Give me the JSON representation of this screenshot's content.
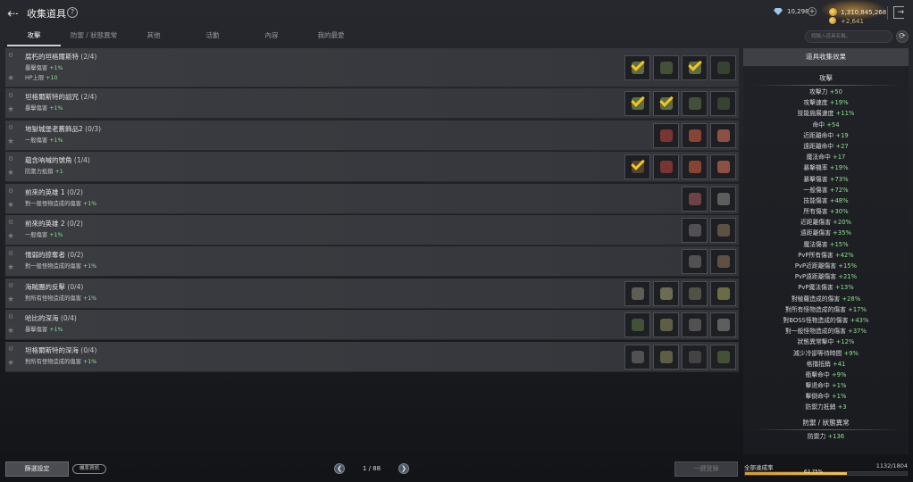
{
  "header": {
    "title": "收集道具",
    "help_icon": "?",
    "diamond": "10,298",
    "silver": "1,310,845,268",
    "silver_sub": "+2,641"
  },
  "tabs": [
    {
      "label": "攻擊",
      "active": true
    },
    {
      "label": "防禦 / 狀態異常",
      "active": false
    },
    {
      "label": "其他",
      "active": false
    },
    {
      "label": "活動",
      "active": false
    },
    {
      "label": "內容",
      "active": false
    },
    {
      "label": "我的最愛",
      "active": false
    }
  ],
  "search": {
    "placeholder": "請輸入道具名稱。"
  },
  "collections": [
    {
      "name": "腐朽的坦格爾斯特",
      "count": "(2/4)",
      "effects": [
        {
          "label": "暴擊傷害",
          "value": "+1%"
        },
        {
          "label": "HP上限",
          "value": "+10"
        }
      ],
      "slots": [
        {
          "checked": true,
          "color": "#6a7a4a"
        },
        {
          "checked": false,
          "color": "#4a5a3a"
        },
        {
          "checked": true,
          "color": "#6a7a4a"
        },
        {
          "checked": false,
          "color": "#3a4a32"
        }
      ]
    },
    {
      "name": "坦格爾斯特的詛咒",
      "count": "(2/4)",
      "effects": [
        {
          "label": "暴擊傷害",
          "value": "+1%"
        }
      ],
      "slots": [
        {
          "checked": true,
          "color": "#6a7a4a"
        },
        {
          "checked": true,
          "color": "#6a7a4a"
        },
        {
          "checked": false,
          "color": "#4a5a3a"
        },
        {
          "checked": false,
          "color": "#3a4a32"
        }
      ]
    },
    {
      "name": "地獄城堡老舊飾品2",
      "count": "(0/3)",
      "effects": [
        {
          "label": "一般傷害",
          "value": "+1%"
        }
      ],
      "slots": [
        {
          "checked": false,
          "color": "#8a3a34"
        },
        {
          "checked": false,
          "color": "#9a4a3a"
        },
        {
          "checked": false,
          "color": "#a05a4a"
        }
      ]
    },
    {
      "name": "蘊含吶喊的號角",
      "count": "(1/4)",
      "effects": [
        {
          "label": "防禦力抵銷",
          "value": "+1"
        }
      ],
      "slots": [
        {
          "checked": true,
          "color": "#5a4a3a"
        },
        {
          "checked": false,
          "color": "#8a3a34"
        },
        {
          "checked": false,
          "color": "#9a4a3a"
        },
        {
          "checked": false,
          "color": "#a05a4a"
        }
      ]
    },
    {
      "name": "前來的英雄 1",
      "count": "(0/2)",
      "effects": [
        {
          "label": "對一般怪物造成的傷害",
          "value": "+1%"
        }
      ],
      "slots": [
        {
          "checked": false,
          "color": "#7a4a4a"
        },
        {
          "checked": false,
          "color": "#6a6a6a"
        }
      ]
    },
    {
      "name": "前來的英雄 2",
      "count": "(0/2)",
      "effects": [
        {
          "label": "一般傷害",
          "value": "+1%"
        }
      ],
      "slots": [
        {
          "checked": false,
          "color": "#5a5a5a"
        },
        {
          "checked": false,
          "color": "#6a5a4a"
        }
      ]
    },
    {
      "name": "懦弱的掠奪者",
      "count": "(0/2)",
      "effects": [
        {
          "label": "對一般怪物造成的傷害",
          "value": "+1%"
        }
      ],
      "slots": [
        {
          "checked": false,
          "color": "#5a5a5a"
        },
        {
          "checked": false,
          "color": "#6a5a4a"
        }
      ]
    },
    {
      "name": "海賊團的反擊",
      "count": "(0/4)",
      "effects": [
        {
          "label": "對所有怪物造成的傷害",
          "value": "+1%"
        }
      ],
      "slots": [
        {
          "checked": false,
          "color": "#6a6a5a"
        },
        {
          "checked": false,
          "color": "#7a7a5a"
        },
        {
          "checked": false,
          "color": "#5a5a4a"
        },
        {
          "checked": false,
          "color": "#7a7a4a"
        }
      ]
    },
    {
      "name": "哈比的深海",
      "count": "(0/4)",
      "effects": [
        {
          "label": "暴擊傷害",
          "value": "+1%"
        }
      ],
      "slots": [
        {
          "checked": false,
          "color": "#4a5a3a"
        },
        {
          "checked": false,
          "color": "#6a6a4a"
        },
        {
          "checked": false,
          "color": "#5a5a5a"
        },
        {
          "checked": false,
          "color": "#6a6a6a"
        }
      ]
    },
    {
      "name": "坦格爾斯特的深海",
      "count": "(0/4)",
      "effects": [
        {
          "label": "對所有怪物造成的傷害",
          "value": "+1%"
        }
      ],
      "slots": [
        {
          "checked": false,
          "color": "#5a5a5a"
        },
        {
          "checked": false,
          "color": "#6a6a4a"
        },
        {
          "checked": false,
          "color": "#4a4a4a"
        },
        {
          "checked": false,
          "color": "#4a5a3a"
        }
      ]
    }
  ],
  "panel": {
    "title": "道具收集效果",
    "attack_title": "攻擊",
    "attack_stats": [
      {
        "label": "攻擊力",
        "value": "+50"
      },
      {
        "label": "攻擊速度",
        "value": "+19%"
      },
      {
        "label": "技能施展速度",
        "value": "+11%"
      },
      {
        "label": "命中",
        "value": "+54"
      },
      {
        "label": "近距離命中",
        "value": "+19"
      },
      {
        "label": "遠距離命中",
        "value": "+27"
      },
      {
        "label": "魔法命中",
        "value": "+17"
      },
      {
        "label": "暴擊機率",
        "value": "+19%"
      },
      {
        "label": "暴擊傷害",
        "value": "+73%"
      },
      {
        "label": "一般傷害",
        "value": "+72%"
      },
      {
        "label": "技能傷害",
        "value": "+48%"
      },
      {
        "label": "所有傷害",
        "value": "+30%"
      },
      {
        "label": "近距離傷害",
        "value": "+20%"
      },
      {
        "label": "遠距離傷害",
        "value": "+35%"
      },
      {
        "label": "魔法傷害",
        "value": "+15%"
      },
      {
        "label": "PvP所有傷害",
        "value": "+42%"
      },
      {
        "label": "PvP近距離傷害",
        "value": "+15%"
      },
      {
        "label": "PvP遠距離傷害",
        "value": "+21%"
      },
      {
        "label": "PvP魔法傷害",
        "value": "+13%"
      },
      {
        "label": "對稜蘿造成的傷害",
        "value": "+28%"
      },
      {
        "label": "對所有怪物造成的傷害",
        "value": "+17%"
      },
      {
        "label": "對BOSS怪物造成的傷害",
        "value": "+43%"
      },
      {
        "label": "對一般怪物造成的傷害",
        "value": "+37%"
      },
      {
        "label": "狀態異常擊中",
        "value": "+12%"
      },
      {
        "label": "減少冷卻等待時間",
        "value": "+9%"
      },
      {
        "label": "格擋抵銷",
        "value": "+41"
      },
      {
        "label": "衝擊命中",
        "value": "+9%"
      },
      {
        "label": "擊退命中",
        "value": "+1%"
      },
      {
        "label": "擊倒命中",
        "value": "+1%"
      },
      {
        "label": "防禦力抵銷",
        "value": "+3"
      }
    ],
    "defense_title": "防禦 / 狀態異常",
    "defense_stats": [
      {
        "label": "防禦力",
        "value": "+136"
      }
    ]
  },
  "bottom": {
    "filter_label": "篩選設定",
    "probability_label": "機率資訊",
    "page": "1 / 88",
    "register_label": "一鍵登錄",
    "achievement_label": "全部達成率",
    "achievement_value": "1132/1804",
    "achievement_fraction": 0.6275,
    "achievement_pct": "62.75%"
  },
  "colors": {
    "check": "#f5c518",
    "stat_value": "#8fe08f",
    "progress": "#f2c14e"
  }
}
